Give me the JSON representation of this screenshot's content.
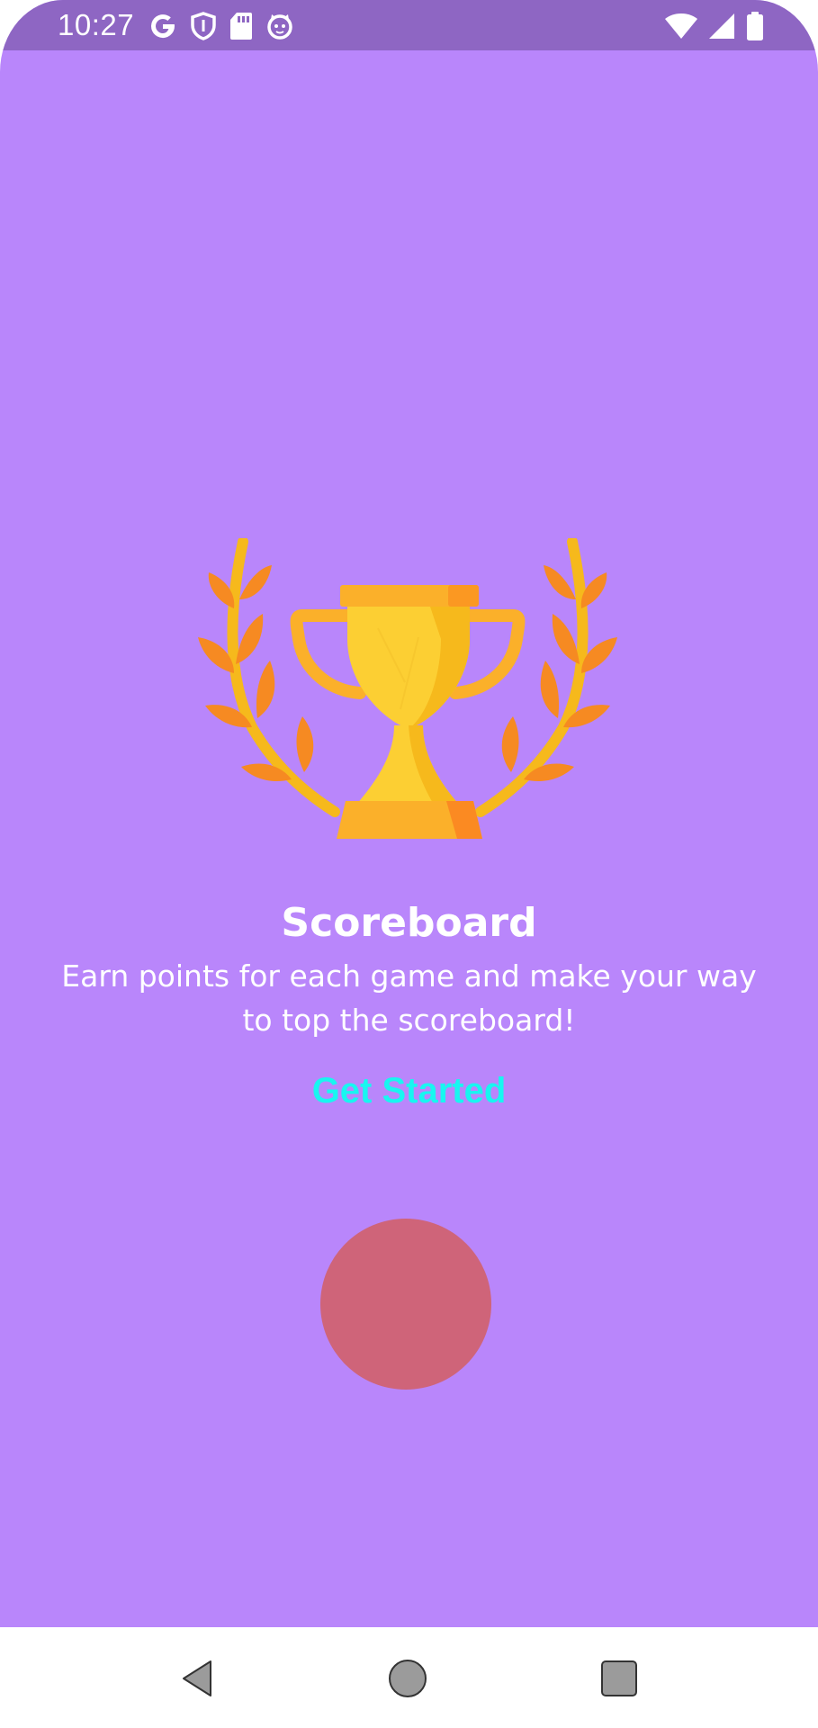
{
  "status_bar": {
    "time": "10:27",
    "background_color": "#8e66c3",
    "left_icons": [
      "google-icon",
      "shield-icon",
      "sd-card-icon",
      "cat-face-icon"
    ],
    "right_icons": [
      "wifi-icon",
      "cellular-signal-icon",
      "battery-icon"
    ]
  },
  "background_color": "#b986fb",
  "illustration": {
    "icon": "trophy-with-laurels-icon"
  },
  "content": {
    "title": "Scoreboard",
    "subtitle": "Earn points for each game and make your way to top the scoreboard!",
    "cta_label": "Get Started",
    "cta_color": "#18f6f0"
  },
  "action_button": {
    "color": "#cf6479"
  },
  "navigation_bar": {
    "buttons": [
      "back-icon",
      "home-icon",
      "recents-icon"
    ]
  }
}
